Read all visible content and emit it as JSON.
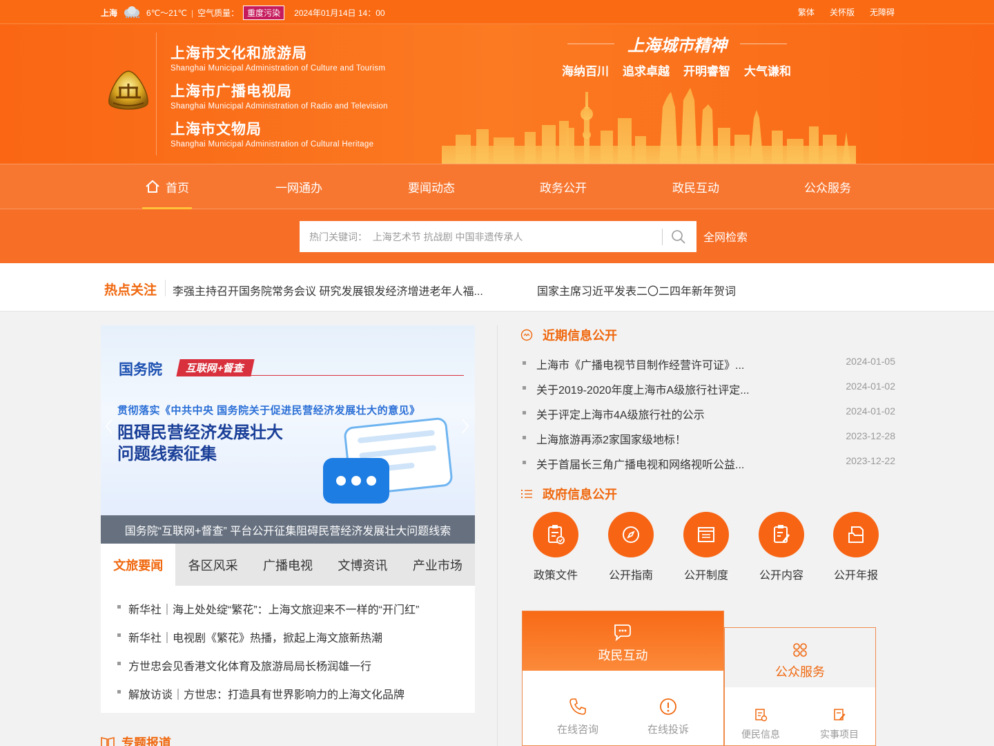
{
  "topbar": {
    "city": "上海",
    "temperature": "6℃～21℃",
    "air_label": "空气质量：",
    "air_status": "重度污染",
    "datetime": "2024年01月14日 14：00",
    "links": [
      "繁体",
      "关怀版",
      "无障碍"
    ]
  },
  "header": {
    "orgs": [
      {
        "cn": "上海市文化和旅游局",
        "en": "Shanghai Municipal Administration of Culture and Tourism"
      },
      {
        "cn": "上海市广播电视局",
        "en": "Shanghai Municipal Administration of Radio and Television"
      },
      {
        "cn": "上海市文物局",
        "en": "Shanghai Municipal Administration of Cultural Heritage"
      }
    ],
    "slogan_title": "上海城市精神",
    "slogans": [
      "海纳百川",
      "追求卓越",
      "开明睿智",
      "大气谦和"
    ]
  },
  "nav": {
    "items": [
      "首页",
      "一网通办",
      "要闻动态",
      "政务公开",
      "政民互动",
      "公众服务"
    ],
    "active": 0
  },
  "search": {
    "placeholder": "热门关键词：  上海艺术节 抗战剧 中国非遗传承人",
    "button_label": "全网检索"
  },
  "hot": {
    "title": "热点关注",
    "items": [
      "李强主持召开国务院常务会议 研究发展银发经济增进老年人福...",
      "国家主席习近平发表二〇二四年新年贺词"
    ]
  },
  "banner": {
    "org": "国务院",
    "tag": "互联网+督查",
    "subtitle": "贯彻落实《中共中央 国务院关于促进民营经济发展壮大的意见》",
    "headline_1": "阻碍民营经济发展壮大",
    "headline_2": "问题线索征集",
    "caption": "国务院“互联网+督查” 平台公开征集阻碍民营经济发展壮大问题线索"
  },
  "news_tabs": {
    "tabs": [
      "文旅要闻",
      "各区风采",
      "广播电视",
      "文博资讯",
      "产业市场"
    ],
    "active": 0,
    "items": [
      "新华社｜海上处处绽“繁花”：上海文旅迎来不一样的“开门红”",
      "新华社｜电视剧《繁花》热播，掀起上海文旅新热潮",
      "方世忠会见香港文化体育及旅游局局长杨润雄一行",
      "解放访谈｜方世忠：打造具有世界影响力的上海文化品牌"
    ]
  },
  "special": {
    "title": "专题报道"
  },
  "recent_info": {
    "title": "近期信息公开",
    "items": [
      {
        "title": "上海市《广播电视节目制作经营许可证》...",
        "date": "2024-01-05"
      },
      {
        "title": "关于2019-2020年度上海市A级旅行社评定...",
        "date": "2024-01-02"
      },
      {
        "title": "关于评定上海市4A级旅行社的公示",
        "date": "2024-01-02"
      },
      {
        "title": "上海旅游再添2家国家级地标！",
        "date": "2023-12-28"
      },
      {
        "title": "关于首届长三角广播电视和网络视听公益...",
        "date": "2023-12-22"
      }
    ]
  },
  "gov_info": {
    "title": "政府信息公开",
    "items": [
      {
        "label": "政策文件",
        "icon": "policy-document-icon"
      },
      {
        "label": "公开指南",
        "icon": "compass-icon"
      },
      {
        "label": "公开制度",
        "icon": "system-list-icon"
      },
      {
        "label": "公开内容",
        "icon": "content-edit-icon"
      },
      {
        "label": "公开年报",
        "icon": "annual-report-icon"
      }
    ]
  },
  "interaction": {
    "title": "政民互动",
    "items": [
      "在线咨询",
      "在线投诉"
    ]
  },
  "public_service": {
    "title": "公众服务",
    "items": [
      "便民信息",
      "实事项目"
    ]
  },
  "colors": {
    "brand_orange": "#fa6a12",
    "accent_text": "#f0680f",
    "nav_underline": "#ffc33a",
    "pollution_badge": "#c51a5c"
  }
}
